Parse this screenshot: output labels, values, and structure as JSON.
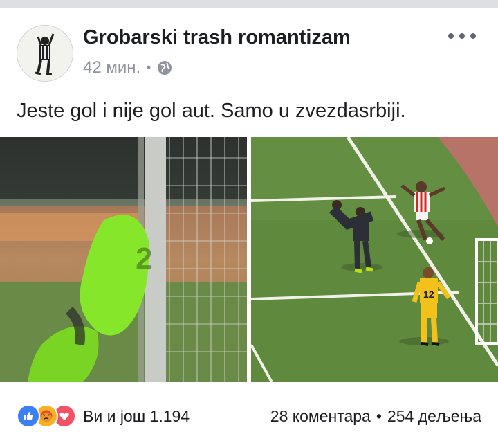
{
  "post": {
    "author": "Grobarski trash romantizam",
    "time": "42 мин.",
    "separator": "•",
    "privacy_icon": "globe-icon",
    "more_icon": "more-options-icon",
    "text": "Jeste gol i nije gol aut. Samo u zvezdasrbiji."
  },
  "photos": [
    {
      "icon": "photo-goalkeeper-dive",
      "jersey_number": ""
    },
    {
      "icon": "photo-match-goal-line",
      "jersey_number": "12"
    }
  ],
  "footer": {
    "reaction_icons": [
      "like-icon",
      "angry-icon",
      "love-icon"
    ],
    "reactions_text": "Ви и још 1.194",
    "comments": "28 коментара",
    "separator": "•",
    "shares": "254 дељења"
  },
  "colors": {
    "like": "#3b7ff5",
    "angry": "#f7b125",
    "love": "#f25268",
    "pitch": "#5f8a3e",
    "meta": "#90949c"
  }
}
